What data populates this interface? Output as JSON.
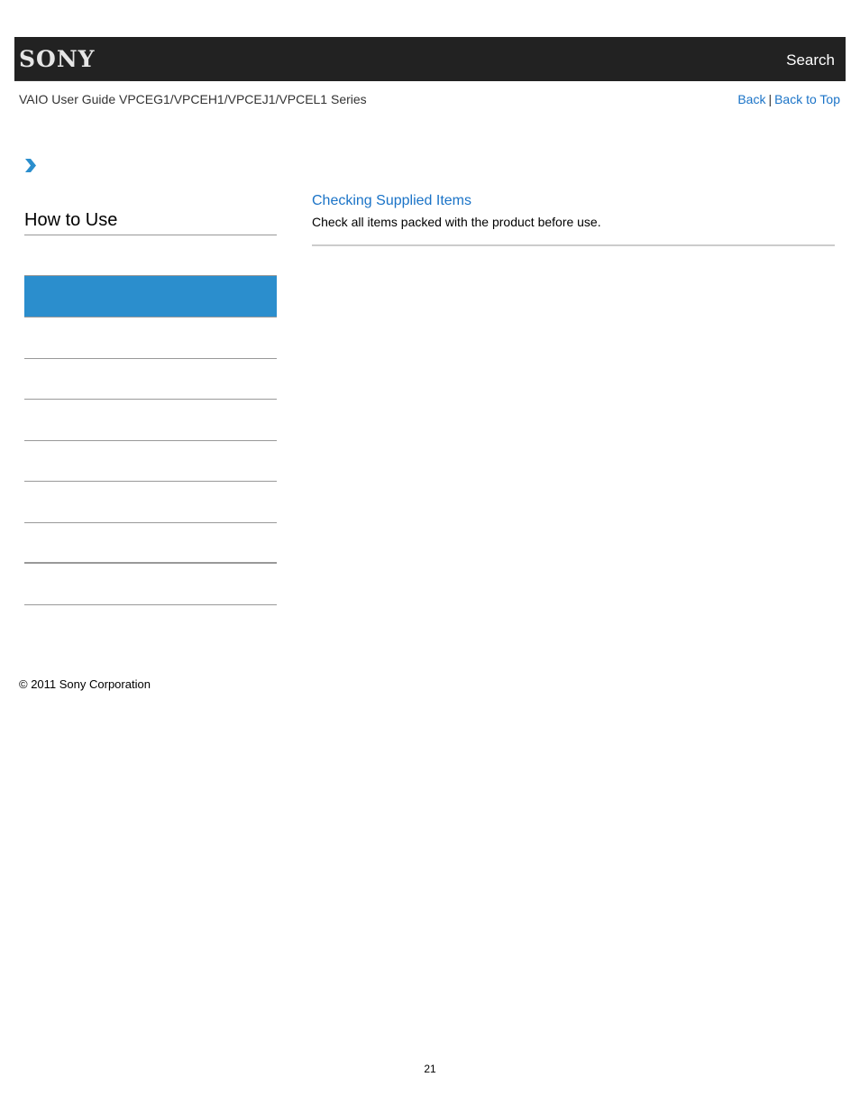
{
  "header": {
    "logo": "SONY",
    "search_label": "Search"
  },
  "subheader": {
    "guide_title": "VAIO User Guide VPCEG1/VPCEH1/VPCEJ1/VPCEL1 Series",
    "back_label": "Back",
    "separator": "|",
    "back_to_top_label": "Back to Top"
  },
  "breadcrumb": {
    "icon": "chevron-right-icon"
  },
  "sidebar": {
    "title": "How to Use",
    "items": [
      {
        "label": "",
        "active": true
      },
      {
        "label": "",
        "active": false
      },
      {
        "label": "",
        "active": false
      },
      {
        "label": "",
        "active": false
      },
      {
        "label": "",
        "active": false
      },
      {
        "label": "",
        "active": false
      },
      {
        "label": "",
        "active": false
      },
      {
        "label": "",
        "active": false
      },
      {
        "label": "",
        "active": false
      }
    ]
  },
  "main": {
    "topics": [
      {
        "title": "Checking Supplied Items",
        "description": "Check all items packed with the product before use."
      }
    ]
  },
  "footer": {
    "copyright": "© 2011 Sony Corporation",
    "page_number": "21"
  },
  "colors": {
    "header_bg": "#222222",
    "link": "#1a73c7",
    "active_item": "#2b8ecd",
    "chevron": "#2b8ecd"
  }
}
